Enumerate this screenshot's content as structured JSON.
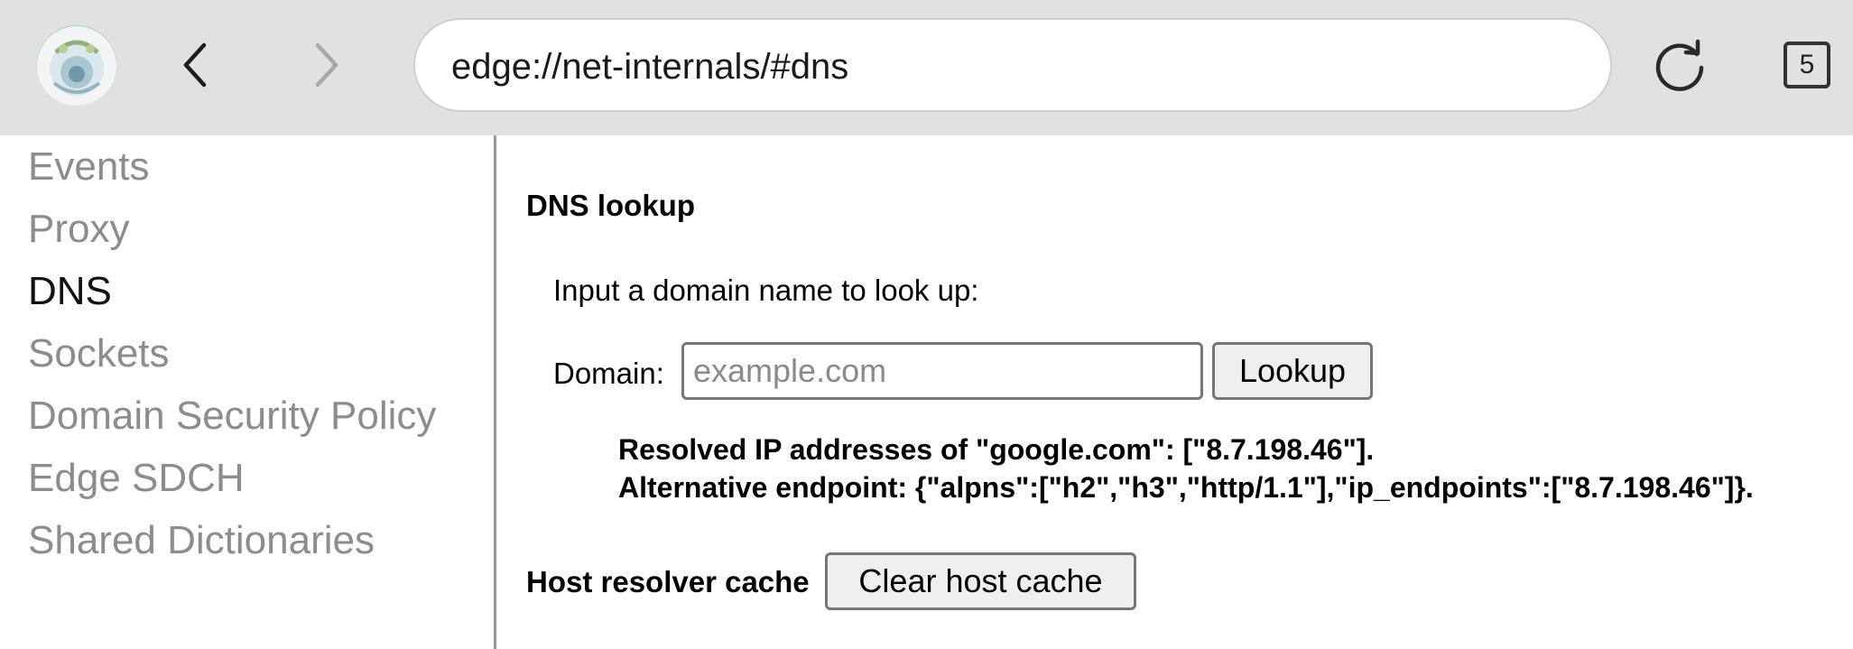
{
  "browser": {
    "profile_icon": "profile-avatar",
    "back_icon": "chevron-left-icon",
    "forward_icon": "chevron-right-icon",
    "address": "edge://net-internals/#dns",
    "reload_icon": "reload-icon",
    "tab_count": "5"
  },
  "sidebar": {
    "items": [
      {
        "label": "Events",
        "active": false
      },
      {
        "label": "Proxy",
        "active": false
      },
      {
        "label": "DNS",
        "active": true
      },
      {
        "label": "Sockets",
        "active": false
      },
      {
        "label": "Domain Security Policy",
        "active": false
      },
      {
        "label": "Edge SDCH",
        "active": false
      },
      {
        "label": "Shared Dictionaries",
        "active": false
      }
    ]
  },
  "main": {
    "lookup_heading": "DNS lookup",
    "lookup_prompt": "Input a domain name to look up:",
    "domain_label": "Domain:",
    "domain_placeholder": "example.com",
    "domain_value": "",
    "lookup_button": "Lookup",
    "result_line1": "Resolved IP addresses of \"google.com\": [\"8.7.198.46\"].",
    "result_line2": "Alternative endpoint: {\"alpns\":[\"h2\",\"h3\",\"http/1.1\"],\"ip_endpoints\":[\"8.7.198.46\"]}.",
    "cache_label": "Host resolver cache",
    "clear_cache_button": "Clear host cache"
  },
  "colors": {
    "topbar_bg": "#e1e1e1",
    "sidebar_inactive": "#8c8c8c",
    "sidebar_active": "#111111",
    "button_bg": "#efefef"
  }
}
